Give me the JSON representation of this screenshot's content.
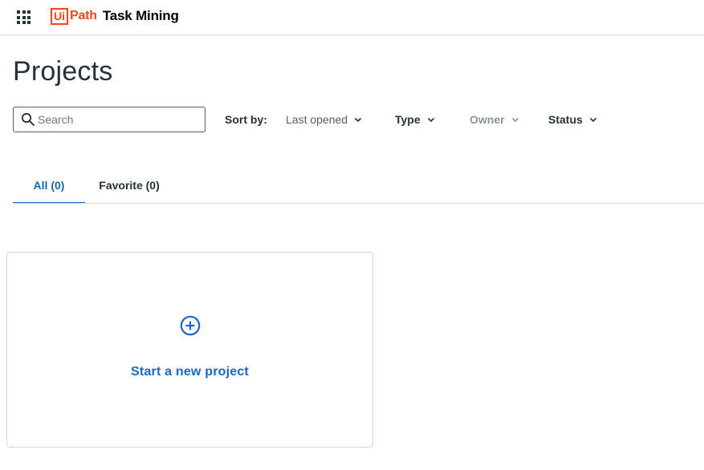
{
  "header": {
    "logo_ui": "Ui",
    "logo_path": "Path",
    "product": "Task Mining"
  },
  "page": {
    "title": "Projects"
  },
  "search": {
    "placeholder": "Search",
    "value": ""
  },
  "filters": {
    "sort_label": "Sort by:",
    "sort_value": "Last opened",
    "type_label": "Type",
    "owner_label": "Owner",
    "status_label": "Status"
  },
  "tabs": [
    {
      "label": "All (0)",
      "active": true
    },
    {
      "label": "Favorite (0)",
      "active": false
    }
  ],
  "new_project": {
    "label": "Start a new project"
  },
  "colors": {
    "brand": "#fa4616",
    "accent": "#1665b3",
    "text": "#273139",
    "disabled": "#8a969f"
  }
}
